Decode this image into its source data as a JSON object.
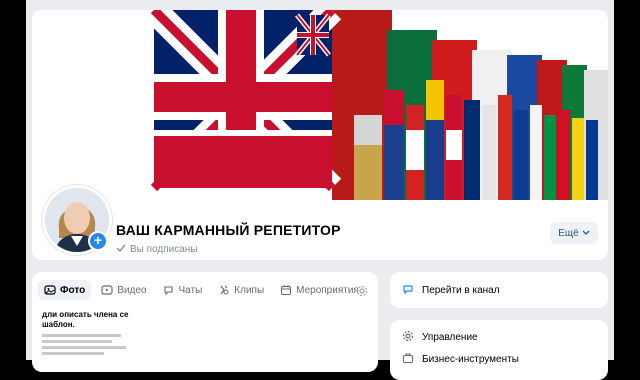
{
  "community": {
    "title": "ВАШ КАРМАННЫЙ РЕПЕТИТОР",
    "subscribed_label": "Вы подписаны",
    "more_label": "Ещё"
  },
  "media_tabs": [
    {
      "label": "Фото",
      "icon": "photo-icon",
      "active": true
    },
    {
      "label": "Видео",
      "icon": "video-icon",
      "active": false
    },
    {
      "label": "Чаты",
      "icon": "chats-icon",
      "active": false
    },
    {
      "label": "Клипы",
      "icon": "clips-icon",
      "active": false
    },
    {
      "label": "Мероприятия",
      "icon": "calendar-icon",
      "active": false
    }
  ],
  "doc_preview": {
    "line1": "дли описать члена се",
    "line2": "шаблон."
  },
  "right": {
    "channel_label": "Перейти в канал",
    "manage_label": "Управление",
    "tools_label": "Бизнес-инструменты"
  },
  "colors": {
    "accent": "#2688eb",
    "page_bg": "#ebedf0",
    "flag_red": "#c8102e",
    "flag_blue": "#012169"
  }
}
